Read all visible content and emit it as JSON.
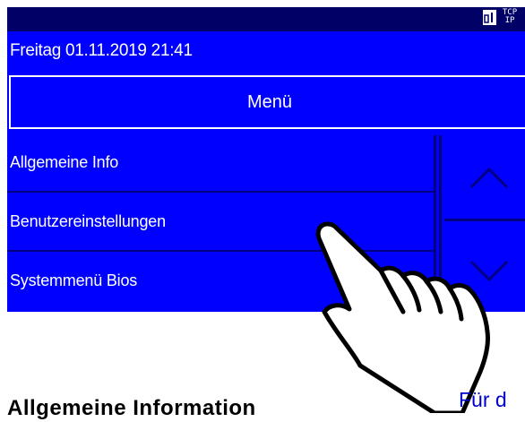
{
  "status_bar": {
    "tcp_label_top": "TCP",
    "tcp_label_bottom": "IP"
  },
  "header": {
    "datetime": "Freitag 01.11.2019 21:41"
  },
  "menu": {
    "title": "Menü",
    "items": [
      {
        "label": "Allgemeine Info"
      },
      {
        "label": "Benutzereinstellungen"
      },
      {
        "label": "Systemmenü Bios"
      }
    ]
  },
  "document": {
    "section_title": "Allgemeine Information",
    "side_note": "Für d"
  },
  "colors": {
    "screen_background": "#0000ff",
    "top_bar": "#000066",
    "text": "#ffffff"
  }
}
